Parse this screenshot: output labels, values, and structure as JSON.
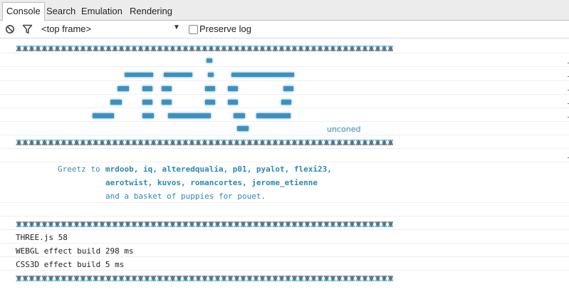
{
  "tabs": [
    {
      "label": "Console",
      "active": true
    },
    {
      "label": "Search",
      "active": false
    },
    {
      "label": "Emulation",
      "active": false
    },
    {
      "label": "Rendering",
      "active": false
    }
  ],
  "toolbar": {
    "clear_icon": "clear-console-icon",
    "filter_icon": "filter-icon",
    "frame_selector": "<top frame>",
    "preserve_log_label": "Preserve log",
    "preserve_log_checked": false
  },
  "console": {
    "logo_credit": "unconed",
    "greetz_label": "Greetz to",
    "greetz_line1": "mrdoob, iq, alteredqualia, p01, pyalot, flexi23,",
    "greetz_line2": "aerotwist, kuvos, romancortes, jerome_etienne",
    "greetz_line3": "and a basket of puppies for pouet.",
    "logs": [
      "THREE.js 58",
      "WEBGL effect build 298 ms",
      "CSS3D effect build 5 ms"
    ]
  },
  "colors": {
    "banner_light": "#7dbfe0",
    "banner_dark": "#26333d",
    "logo_blue": "#3a8ec0",
    "greetz_blue": "#2b88b8"
  }
}
